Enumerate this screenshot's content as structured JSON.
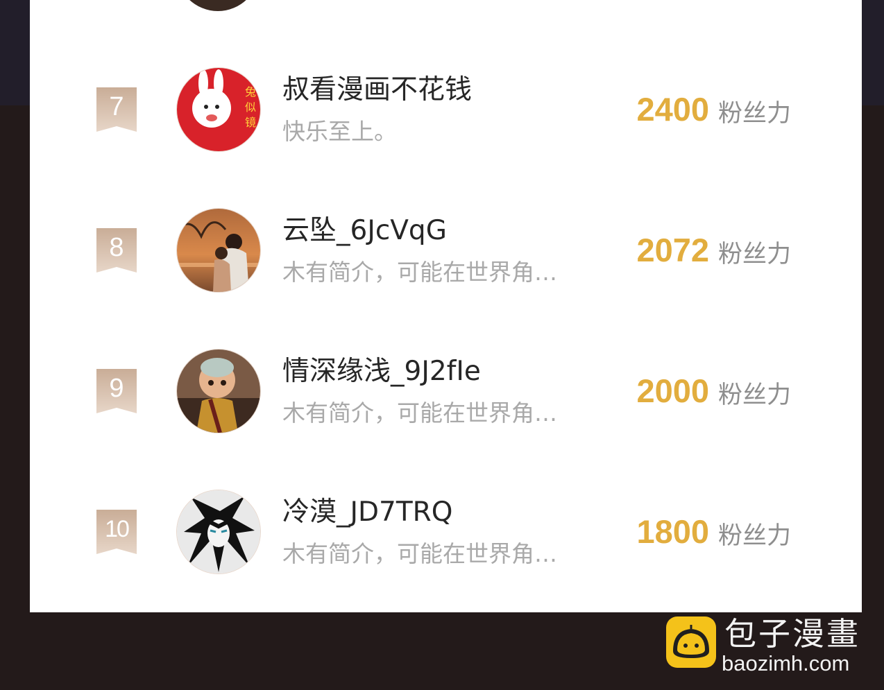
{
  "ranking": {
    "items": [
      {
        "rank": "7",
        "name": "叔看漫画不花钱",
        "bio": "快乐至上。",
        "score": "2400",
        "unit": "粉丝力"
      },
      {
        "rank": "8",
        "name": "云坠_6JcVqG",
        "bio": "木有简介，可能在世界角…",
        "score": "2072",
        "unit": "粉丝力"
      },
      {
        "rank": "9",
        "name": "情深缘浅_9J2fIe",
        "bio": "木有简介，可能在世界角…",
        "score": "2000",
        "unit": "粉丝力"
      },
      {
        "rank": "10",
        "name": "冷漠_JD7TRQ",
        "bio": "木有简介，可能在世界角…",
        "score": "1800",
        "unit": "粉丝力"
      }
    ]
  },
  "watermark": {
    "brand_cn": "包子漫畫",
    "brand_en": "baozimh.com"
  },
  "colors": {
    "score": "#e2ad3e",
    "badge": "#d3baa4",
    "background": "#231a1a"
  }
}
